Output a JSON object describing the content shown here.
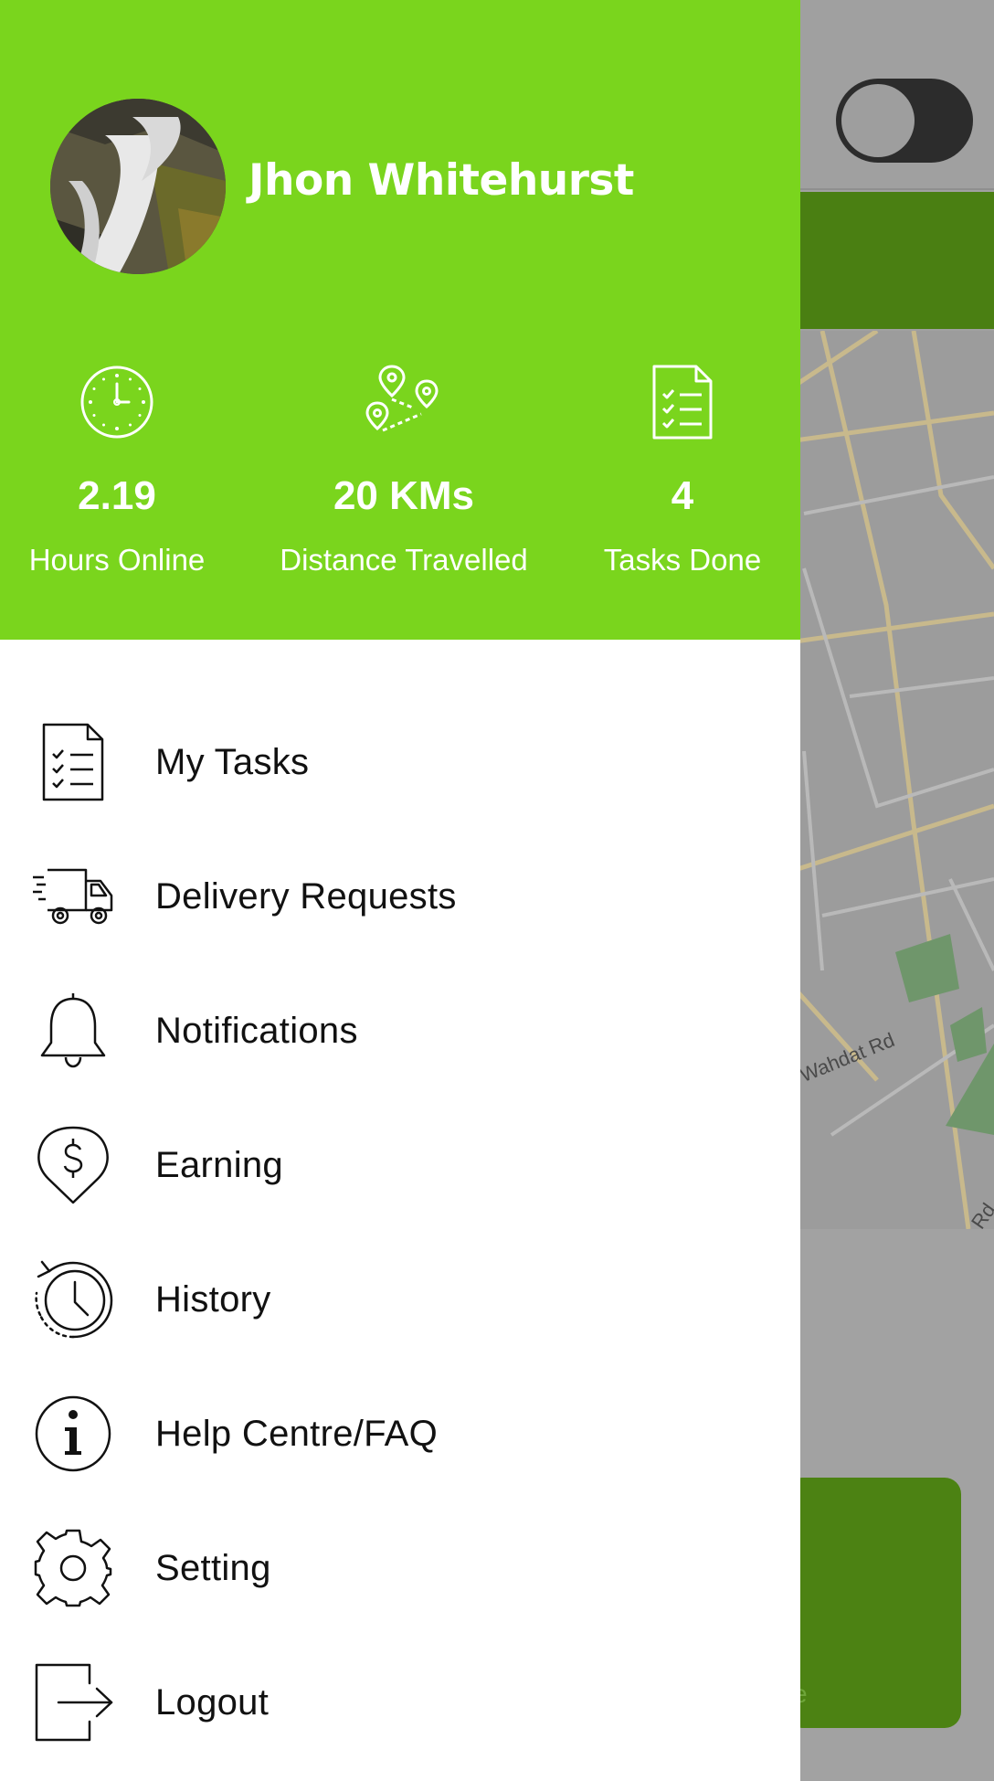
{
  "background": {
    "road_labels": [
      "Wahdat Rd",
      "Rd"
    ],
    "card_text": "e"
  },
  "profile": {
    "name": "Jhon Whitehurst"
  },
  "stats": [
    {
      "icon": "clock-icon",
      "value": "2.19",
      "label": "Hours Online"
    },
    {
      "icon": "route-pins-icon",
      "value": "20 KMs",
      "label": "Distance Travelled"
    },
    {
      "icon": "checklist-icon",
      "value": "4",
      "label": "Tasks Done"
    }
  ],
  "menu": [
    {
      "icon": "checklist-icon",
      "label": "My Tasks"
    },
    {
      "icon": "delivery-truck-icon",
      "label": "Delivery Requests"
    },
    {
      "icon": "bell-icon",
      "label": "Notifications"
    },
    {
      "icon": "dollar-pin-icon",
      "label": "Earning"
    },
    {
      "icon": "history-icon",
      "label": "History"
    },
    {
      "icon": "info-icon",
      "label": "Help Centre/FAQ"
    },
    {
      "icon": "gear-icon",
      "label": "Setting"
    },
    {
      "icon": "logout-icon",
      "label": "Logout"
    }
  ],
  "colors": {
    "header_green": "#7ad51d",
    "dim_green": "#4a7f12",
    "text_dark": "#111111",
    "white": "#ffffff"
  }
}
